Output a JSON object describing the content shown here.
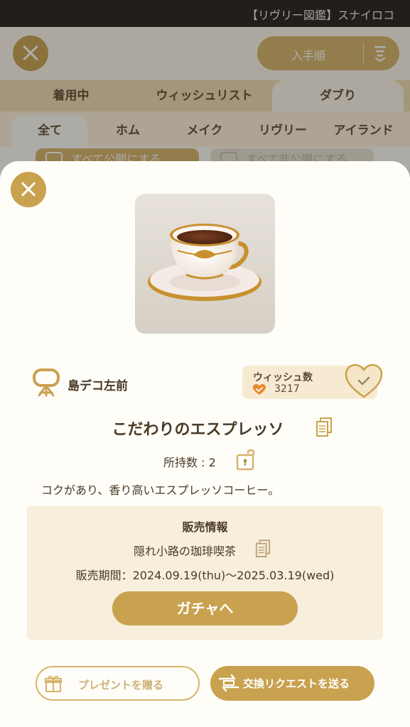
{
  "background": {
    "topbar_title": "【リヴリー図鑑】スナイロコ",
    "sort_label": "入手順",
    "tabs_primary": [
      {
        "label": "着用中"
      },
      {
        "label": "ウィッシュリスト"
      },
      {
        "label": "ダブり"
      }
    ],
    "tabs_secondary": [
      {
        "label": "全て"
      },
      {
        "label": "ホム"
      },
      {
        "label": "メイク"
      },
      {
        "label": "リヴリー"
      },
      {
        "label": "アイランド"
      }
    ],
    "publish_all": "すべて公開にする",
    "unpublish_all": "すべて非公開にする"
  },
  "modal": {
    "category": "島デコ左前",
    "wish": {
      "title": "ウィッシュ数",
      "count": "3217"
    },
    "item_name": "こだわりのエスプレッソ",
    "owned": "所持数 : 2",
    "description": "コクがあり、香り高いエスプレッソコーヒー。",
    "sale": {
      "title": "販売情報",
      "shop": "隠れ小路の珈琲喫茶",
      "period": "販売期間：2024.09.19(thu)〜2025.03.19(wed)",
      "gacha_button": "ガチャへ"
    },
    "present_button": "プレゼントを贈る",
    "exchange_button": "交換リクエストを送る"
  },
  "colors": {
    "gold": "#c9a24f",
    "light_gold": "#d6b46a",
    "cream": "#f7eedb",
    "text": "#4a3a26"
  }
}
